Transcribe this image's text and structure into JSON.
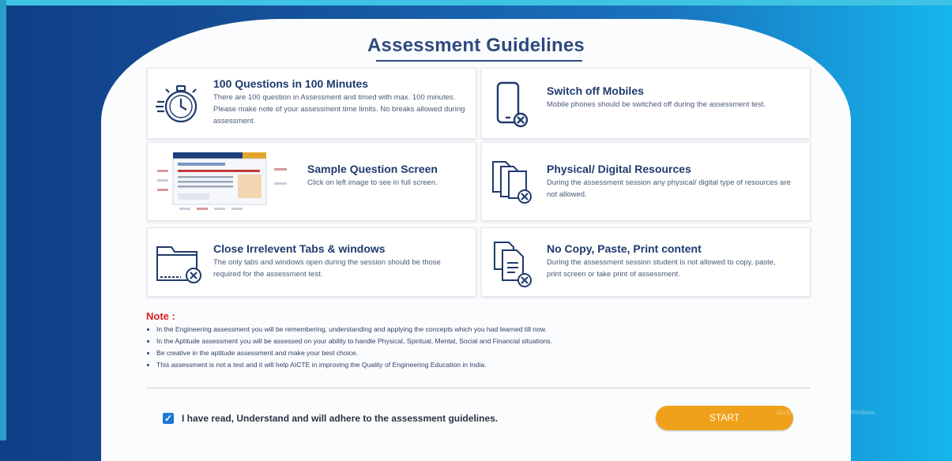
{
  "page": {
    "title": "Assessment Guidelines"
  },
  "guidelines": [
    {
      "heading": "100 Questions in 100 Minutes",
      "text": "There are 100 question in Assessment and timed with max. 100 minutes. Please make note of your assessment time limits. No breaks allowed during assessment.",
      "icon": "stopwatch-icon"
    },
    {
      "heading": "Switch off Mobiles",
      "text": "Mobile phones should be switched off during the assessment test.",
      "icon": "mobile-off-icon"
    },
    {
      "heading": "Sample Question Screen",
      "text": "Click on left image to see in full screen.",
      "icon": "screen-thumbnail"
    },
    {
      "heading": "Physical/ Digital Resources",
      "text": "During the assessment session any physical/ digital type of resources are not allowed.",
      "icon": "documents-off-icon"
    },
    {
      "heading": "Close Irrelevent Tabs & windows",
      "text": "The only tabs and windows open during the session should be those required for the assessment test.",
      "icon": "folder-close-icon"
    },
    {
      "heading": "No Copy, Paste, Print content",
      "text": "During the assessment session student is not allowed to copy, paste, print screen or take print of assessment.",
      "icon": "no-copy-icon"
    }
  ],
  "note": {
    "label": "Note :",
    "items": [
      "In the Engineering assessment you will be remembering, understanding and applying the concepts which you had learned till now.",
      "In the Aptitude assessment you will be assessed on your ability to handle Physical, Spiritual, Mental, Social and Financial situations.",
      "Be creative in the aptitude assessment and make your best choice.",
      "This assessment is not a test and it will help AICTE in improving the Quality of Engineering Education in India."
    ]
  },
  "agreement": {
    "checked": true,
    "label": "I have read, Understand and will adhere to the assessment guidelines."
  },
  "start_button": {
    "label": "START"
  },
  "watermark": {
    "line1": "Activate Windows",
    "line2": "Go to Settings to activate Windows."
  },
  "colors": {
    "title": "#2e4a7f",
    "note": "#e01e1e",
    "start": "#f0a11b",
    "checkbox": "#1e78d6"
  }
}
